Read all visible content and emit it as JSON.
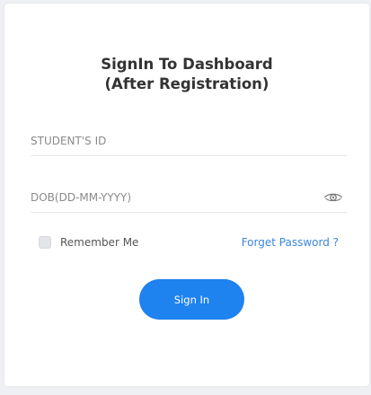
{
  "header": {
    "title_line1": "SignIn To Dashboard",
    "title_line2": "(After Registration)"
  },
  "form": {
    "student_id": {
      "placeholder": "STUDENT'S ID",
      "value": ""
    },
    "dob": {
      "placeholder": "DOB(DD-MM-YYYY)",
      "value": "",
      "icon": "eye-icon"
    },
    "remember_label": "Remember Me",
    "remember_checked": false,
    "forgot_label": "Forget Password ?",
    "submit_label": "Sign In"
  },
  "colors": {
    "accent": "#1e82ef",
    "link": "#3a86d9",
    "title": "#333333",
    "background": "#eef0f3"
  }
}
